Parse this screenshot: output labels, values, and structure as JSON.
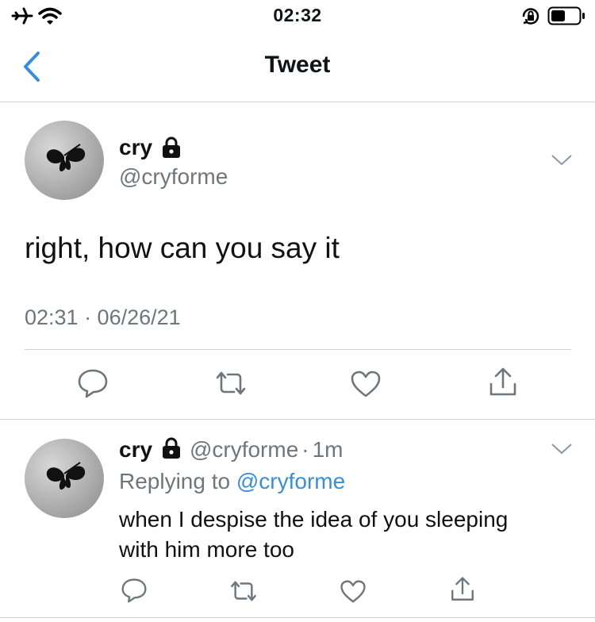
{
  "status_bar": {
    "time": "02:32"
  },
  "nav": {
    "title": "Tweet",
    "back_icon": "chevron-left-icon"
  },
  "tweet": {
    "name": "cry",
    "handle": "@cryforme",
    "text": "right, how can you say it",
    "timestamp": "02:31 · 06/26/21",
    "actions": [
      "reply-icon",
      "retweet-icon",
      "like-icon",
      "share-icon"
    ]
  },
  "reply": {
    "name": "cry",
    "handle": "@cryforme",
    "separator": "·",
    "age": "1m",
    "replying_prefix": "Replying to",
    "replying_to": "@cryforme",
    "text_line1": "when I despise the idea of you sleeping",
    "text_line2": "with him more too"
  },
  "colors": {
    "accent": "#3a8ed8",
    "secondary_text": "#6e767d",
    "divider": "#cfd3d6"
  }
}
